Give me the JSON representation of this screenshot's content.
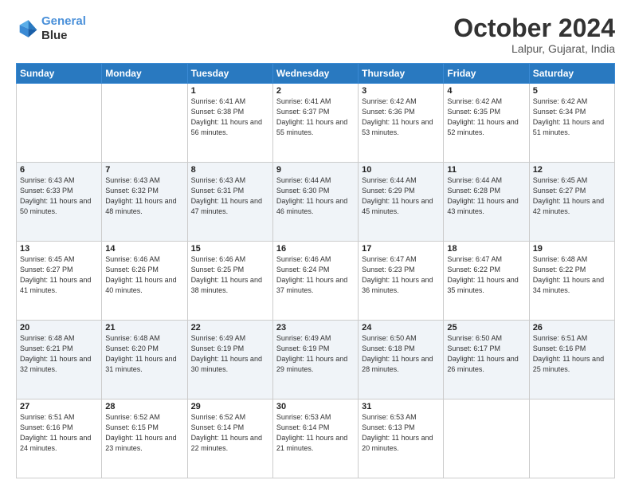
{
  "logo": {
    "line1": "General",
    "line2": "Blue"
  },
  "title": "October 2024",
  "location": "Lalpur, Gujarat, India",
  "weekdays": [
    "Sunday",
    "Monday",
    "Tuesday",
    "Wednesday",
    "Thursday",
    "Friday",
    "Saturday"
  ],
  "weeks": [
    [
      {
        "day": "",
        "info": ""
      },
      {
        "day": "",
        "info": ""
      },
      {
        "day": "1",
        "info": "Sunrise: 6:41 AM\nSunset: 6:38 PM\nDaylight: 11 hours and 56 minutes."
      },
      {
        "day": "2",
        "info": "Sunrise: 6:41 AM\nSunset: 6:37 PM\nDaylight: 11 hours and 55 minutes."
      },
      {
        "day": "3",
        "info": "Sunrise: 6:42 AM\nSunset: 6:36 PM\nDaylight: 11 hours and 53 minutes."
      },
      {
        "day": "4",
        "info": "Sunrise: 6:42 AM\nSunset: 6:35 PM\nDaylight: 11 hours and 52 minutes."
      },
      {
        "day": "5",
        "info": "Sunrise: 6:42 AM\nSunset: 6:34 PM\nDaylight: 11 hours and 51 minutes."
      }
    ],
    [
      {
        "day": "6",
        "info": "Sunrise: 6:43 AM\nSunset: 6:33 PM\nDaylight: 11 hours and 50 minutes."
      },
      {
        "day": "7",
        "info": "Sunrise: 6:43 AM\nSunset: 6:32 PM\nDaylight: 11 hours and 48 minutes."
      },
      {
        "day": "8",
        "info": "Sunrise: 6:43 AM\nSunset: 6:31 PM\nDaylight: 11 hours and 47 minutes."
      },
      {
        "day": "9",
        "info": "Sunrise: 6:44 AM\nSunset: 6:30 PM\nDaylight: 11 hours and 46 minutes."
      },
      {
        "day": "10",
        "info": "Sunrise: 6:44 AM\nSunset: 6:29 PM\nDaylight: 11 hours and 45 minutes."
      },
      {
        "day": "11",
        "info": "Sunrise: 6:44 AM\nSunset: 6:28 PM\nDaylight: 11 hours and 43 minutes."
      },
      {
        "day": "12",
        "info": "Sunrise: 6:45 AM\nSunset: 6:27 PM\nDaylight: 11 hours and 42 minutes."
      }
    ],
    [
      {
        "day": "13",
        "info": "Sunrise: 6:45 AM\nSunset: 6:27 PM\nDaylight: 11 hours and 41 minutes."
      },
      {
        "day": "14",
        "info": "Sunrise: 6:46 AM\nSunset: 6:26 PM\nDaylight: 11 hours and 40 minutes."
      },
      {
        "day": "15",
        "info": "Sunrise: 6:46 AM\nSunset: 6:25 PM\nDaylight: 11 hours and 38 minutes."
      },
      {
        "day": "16",
        "info": "Sunrise: 6:46 AM\nSunset: 6:24 PM\nDaylight: 11 hours and 37 minutes."
      },
      {
        "day": "17",
        "info": "Sunrise: 6:47 AM\nSunset: 6:23 PM\nDaylight: 11 hours and 36 minutes."
      },
      {
        "day": "18",
        "info": "Sunrise: 6:47 AM\nSunset: 6:22 PM\nDaylight: 11 hours and 35 minutes."
      },
      {
        "day": "19",
        "info": "Sunrise: 6:48 AM\nSunset: 6:22 PM\nDaylight: 11 hours and 34 minutes."
      }
    ],
    [
      {
        "day": "20",
        "info": "Sunrise: 6:48 AM\nSunset: 6:21 PM\nDaylight: 11 hours and 32 minutes."
      },
      {
        "day": "21",
        "info": "Sunrise: 6:48 AM\nSunset: 6:20 PM\nDaylight: 11 hours and 31 minutes."
      },
      {
        "day": "22",
        "info": "Sunrise: 6:49 AM\nSunset: 6:19 PM\nDaylight: 11 hours and 30 minutes."
      },
      {
        "day": "23",
        "info": "Sunrise: 6:49 AM\nSunset: 6:19 PM\nDaylight: 11 hours and 29 minutes."
      },
      {
        "day": "24",
        "info": "Sunrise: 6:50 AM\nSunset: 6:18 PM\nDaylight: 11 hours and 28 minutes."
      },
      {
        "day": "25",
        "info": "Sunrise: 6:50 AM\nSunset: 6:17 PM\nDaylight: 11 hours and 26 minutes."
      },
      {
        "day": "26",
        "info": "Sunrise: 6:51 AM\nSunset: 6:16 PM\nDaylight: 11 hours and 25 minutes."
      }
    ],
    [
      {
        "day": "27",
        "info": "Sunrise: 6:51 AM\nSunset: 6:16 PM\nDaylight: 11 hours and 24 minutes."
      },
      {
        "day": "28",
        "info": "Sunrise: 6:52 AM\nSunset: 6:15 PM\nDaylight: 11 hours and 23 minutes."
      },
      {
        "day": "29",
        "info": "Sunrise: 6:52 AM\nSunset: 6:14 PM\nDaylight: 11 hours and 22 minutes."
      },
      {
        "day": "30",
        "info": "Sunrise: 6:53 AM\nSunset: 6:14 PM\nDaylight: 11 hours and 21 minutes."
      },
      {
        "day": "31",
        "info": "Sunrise: 6:53 AM\nSunset: 6:13 PM\nDaylight: 11 hours and 20 minutes."
      },
      {
        "day": "",
        "info": ""
      },
      {
        "day": "",
        "info": ""
      }
    ]
  ]
}
